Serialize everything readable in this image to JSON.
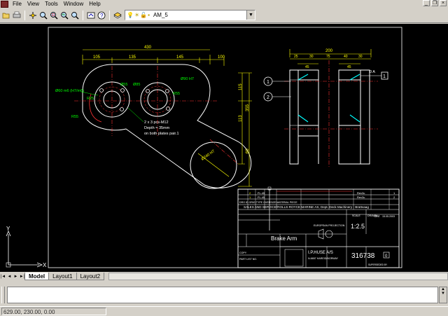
{
  "menu": {
    "items": [
      "File",
      "View",
      "Tools",
      "Window",
      "Help"
    ]
  },
  "window_controls": {
    "minimize": "_",
    "restore": "❐",
    "close": "×"
  },
  "toolbar": {
    "layer_name": "AM_5",
    "layer_icons": "💡☀🔓▪"
  },
  "drawing": {
    "dims": {
      "overall_width": "430",
      "seg1": "105",
      "seg2": "135",
      "seg3": "145",
      "seg4": "100",
      "top_dia": "Ø55",
      "mid_dia": "Ø85",
      "dia_r": "Ø90 H7",
      "r_left": "R55",
      "r_right": "R55",
      "r_top_left": "R25",
      "bot_left": "R55",
      "h1": "115",
      "h2": "113",
      "h3": "355",
      "h4": "60",
      "side_w": "200",
      "side_a": "75",
      "side_b": "30",
      "side_c": "25",
      "side_d": "45",
      "side_e": "40"
    },
    "notes": {
      "left_fit": "Ø60 m6 (H7/m6)",
      "holes": "2 x 3 pcs-M12",
      "depth": "Depth = 35mm",
      "bothpl": "on both plates pair.1",
      "slot": "Ø240 H7"
    },
    "balloons": [
      "1",
      "2",
      "1"
    ],
    "right_tag": "0  A",
    "title_block": {
      "rev_rows": [
        [
          "2",
          "",
          "FL.45",
          "",
          "",
          "",
          "",
          "",
          "",
          "",
          "",
          "Rev3c",
          "",
          "1"
        ],
        [
          "1",
          "",
          "FL.45",
          "",
          "",
          "",
          "",
          "",
          "",
          "",
          "",
          "Rev3c",
          "",
          "2"
        ]
      ],
      "rev_header": "DRG ID  ORIG   TYPE  OVERSIZE                               MATERIAL   PIECE",
      "company": "SALES AND SERVICE/ROLLS-ROYCE MARINE AS, Dept. Deck Machinery - Brattvaag",
      "projection": "EUROPEAN PROJECTION",
      "scale_label": "SCALE",
      "scale": "1:2.5",
      "drawn_label": "DRAWN",
      "drawn": "DM",
      "date": "15.05.2003",
      "title": "Brake Arm",
      "copy_label": "COPY",
      "part_label": "PART LIST NO.",
      "maker": "I.P.HUSE A/S",
      "maker_sub": "N-6657 HAREID/NORWAY",
      "drawing_no": "316738",
      "rev_box": "0",
      "supersedes": "SUPERSEDED BY"
    },
    "ucs": {
      "x": "X",
      "y": "Y"
    }
  },
  "tabs": {
    "items": [
      "Model",
      "Layout1",
      "Layout2"
    ],
    "active": "Model"
  },
  "status": {
    "coordinates": "629.00, 230.00, 0.00"
  },
  "colors": {
    "canvas_bg": "#000000",
    "linework": "#ffffff",
    "dimension": "#ffff00",
    "centerline": "#ff3333",
    "annotation": "#00ff00",
    "hidden": "#00ffff"
  }
}
